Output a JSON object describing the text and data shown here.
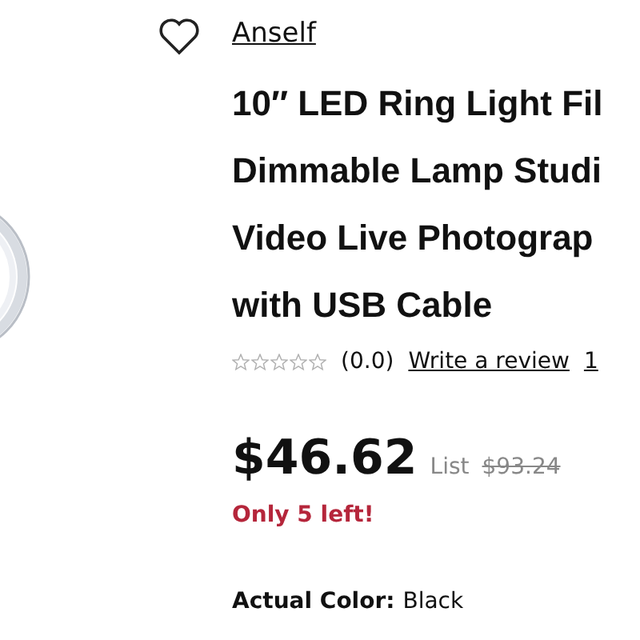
{
  "seller": "Anself",
  "favorite": {
    "selected": false
  },
  "title_lines": [
    "10″ LED Ring Light Fil",
    "Dimmable Lamp Studi",
    "Video Live Photograp",
    "with USB Cable"
  ],
  "rating": {
    "stars": 0,
    "score": "(0.0)",
    "review_link": "Write a review",
    "column_3": "1"
  },
  "price": {
    "current": "$46.62",
    "list_label": "List",
    "list_price": "$93.24"
  },
  "stock_note": "Only 5 left!",
  "color": {
    "label": "Actual Color:",
    "value": "Black"
  }
}
